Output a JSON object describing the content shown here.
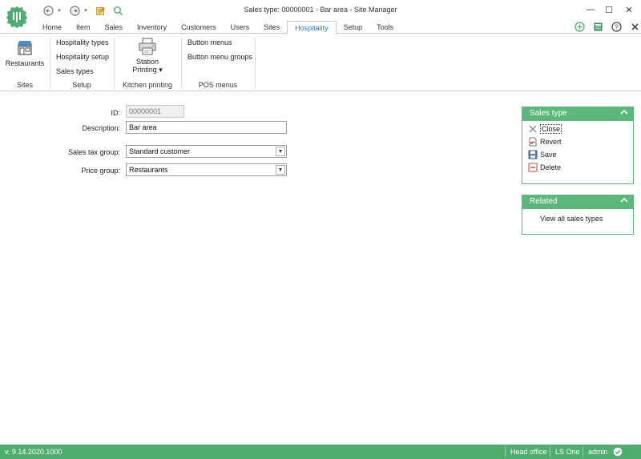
{
  "window": {
    "title": "Sales type: 00000001 - Bar area - Site Manager",
    "minimize_glyph": "—",
    "maximize_glyph": "☐",
    "close_glyph": "✕"
  },
  "quick_access": {
    "back_glyph": "←",
    "forward_glyph": "→",
    "dropdown_glyph": "▾"
  },
  "tabs": [
    {
      "label": "Home"
    },
    {
      "label": "Item"
    },
    {
      "label": "Sales"
    },
    {
      "label": "Inventory"
    },
    {
      "label": "Customers"
    },
    {
      "label": "Users"
    },
    {
      "label": "Sites"
    },
    {
      "label": "Hospitality",
      "active": true
    },
    {
      "label": "Setup"
    },
    {
      "label": "Tools"
    }
  ],
  "ribbon": {
    "sites": {
      "restaurants": "Restaurants",
      "group": "Sites"
    },
    "setup": {
      "hospitality_types": "Hospitality types",
      "hospitality_setup": "Hospitality setup",
      "sales_types": "Sales types",
      "group": "Setup"
    },
    "kitchen": {
      "station_printing_line1": "Station",
      "station_printing_line2": "Printing ▾",
      "group": "Kitchen printing"
    },
    "pos": {
      "button_menus": "Button menus",
      "button_menu_groups": "Button menu groups",
      "group": "POS menus"
    }
  },
  "form": {
    "id_label": "ID:",
    "id_value": "00000001",
    "description_label": "Description:",
    "description_value": "Bar area",
    "sales_tax_group_label": "Sales tax group:",
    "sales_tax_group_value": "Standard customer",
    "price_group_label": "Price group:",
    "price_group_value": "Restaurants"
  },
  "panel_sales_type": {
    "title": "Sales type",
    "items": [
      {
        "label": "Close",
        "icon": "close-icon"
      },
      {
        "label": "Revert",
        "icon": "revert-icon"
      },
      {
        "label": "Save",
        "icon": "save-icon"
      },
      {
        "label": "Delete",
        "icon": "delete-icon"
      }
    ]
  },
  "panel_related": {
    "title": "Related",
    "items": [
      {
        "label": "View all sales types"
      }
    ]
  },
  "status": {
    "version": "v. 9.14.2020.1000",
    "location": "Head office",
    "product": "LS One",
    "user": "admin"
  },
  "colors": {
    "accent": "#5cb87a",
    "status_bar": "#4fae6f",
    "active_tab_text": "#2b7bd6"
  }
}
